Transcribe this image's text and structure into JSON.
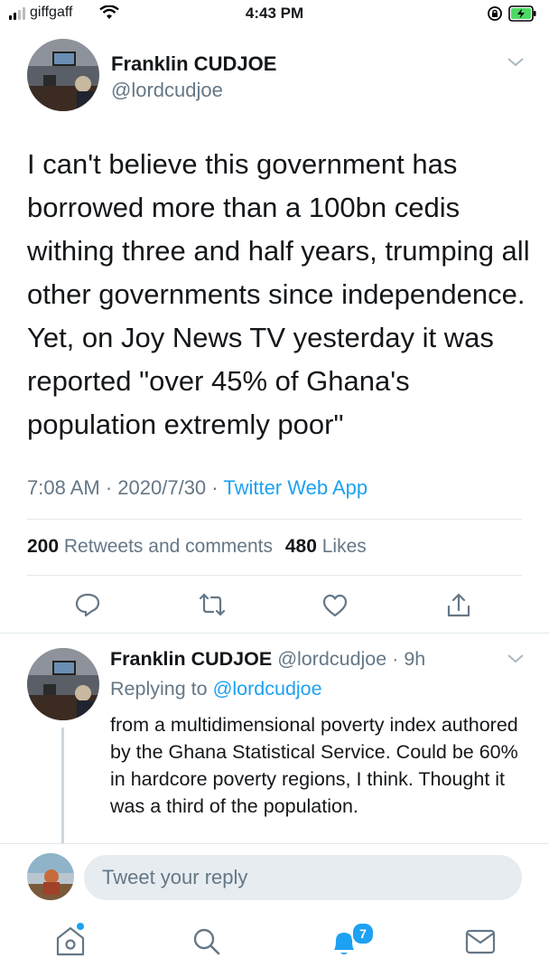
{
  "status_bar": {
    "carrier": "giffgaff",
    "time": "4:43 PM"
  },
  "tweet": {
    "author_name": "Franklin CUDJOE",
    "author_handle": "@lordcudjoe",
    "text": "I can't believe this government has borrowed more than a 100bn cedis withing three and half years, trumping all other governments since independence. Yet, on Joy News TV yesterday it was reported \"over 45% of Ghana's population extremly poor\"",
    "time": "7:08 AM",
    "date": "2020/7/30",
    "separator": "·",
    "source": "Twitter Web App",
    "retweets_count": "200",
    "retweets_label": "Retweets and comments",
    "likes_count": "480",
    "likes_label": "Likes"
  },
  "reply": {
    "author_name": "Franklin CUDJOE",
    "author_handle": "@lordcudjoe",
    "age": "9h",
    "replying_to_label": "Replying to",
    "replying_to_handle": "@lordcudjoe",
    "text": "from a multidimensional poverty index authored by the Ghana Statistical Service. Could be 60% in hardcore poverty regions, I think. Thought it was a third of the population."
  },
  "compose": {
    "placeholder": "Tweet your reply"
  },
  "tabbar": {
    "notifications_badge": "7"
  },
  "colors": {
    "accent": "#1da1f2",
    "secondary_text": "#657786",
    "divider": "#e1e8ed"
  }
}
